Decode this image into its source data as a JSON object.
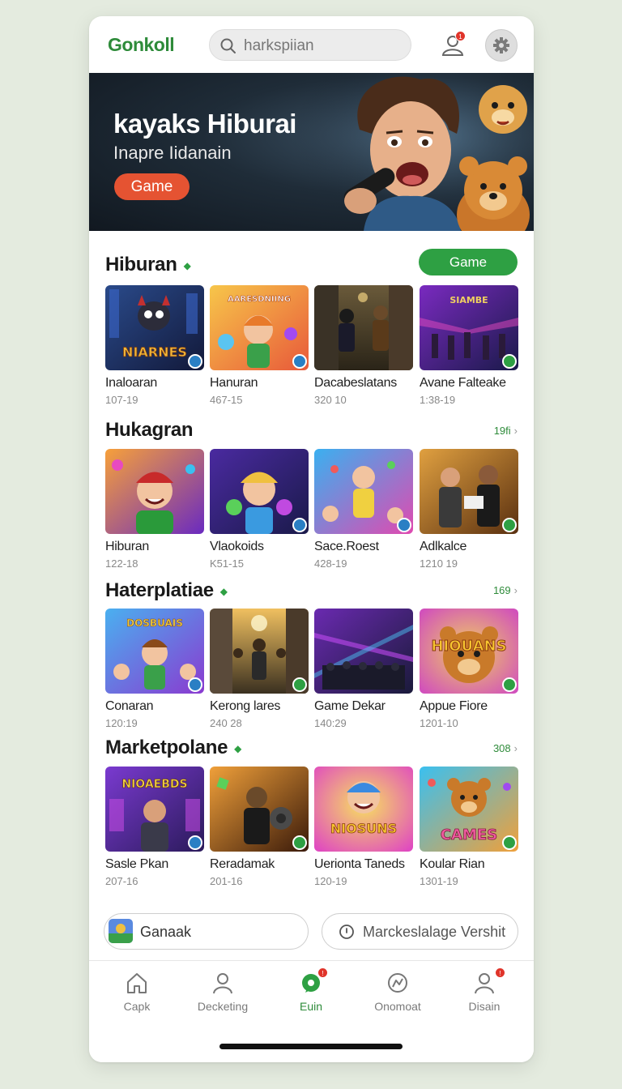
{
  "header": {
    "logo": "Gonkoll",
    "search_placeholder": "harkspiian",
    "notification_count": "1"
  },
  "banner": {
    "title": "kayaks Hiburai",
    "subtitle": "Inapre Iidanain",
    "button": "Game"
  },
  "sections": [
    {
      "title": "Hiburan",
      "action_button": "Game",
      "cards": [
        {
          "title": "Inaloaran",
          "meta": "107-19",
          "thumb_text": "NIARNES"
        },
        {
          "title": "Hanuran",
          "meta": "467-15",
          "thumb_text": "AARESDNIING"
        },
        {
          "title": "Dacabeslatans",
          "meta": "320 10"
        },
        {
          "title": "Avane Falteake",
          "meta": "1:38-19",
          "thumb_text": "SIAMBE"
        }
      ]
    },
    {
      "title": "Hukagran",
      "see_more": "19fi",
      "cards": [
        {
          "title": "Hiburan",
          "meta": "122-18"
        },
        {
          "title": "Vlaokoids",
          "meta": "K51-15"
        },
        {
          "title": "Sace.Roest",
          "meta": "428-19"
        },
        {
          "title": "Adlkalce",
          "meta": "1210 19"
        }
      ]
    },
    {
      "title": "Haterplatiae",
      "see_more": "169",
      "cards": [
        {
          "title": "Conaran",
          "meta": "120:19",
          "thumb_text": "DOSBUAIS"
        },
        {
          "title": "Kerong lares",
          "meta": "240 28"
        },
        {
          "title": "Game Dekar",
          "meta": "140:29"
        },
        {
          "title": "Appue Fiore",
          "meta": "1201-10",
          "thumb_text": "HIOUANS"
        }
      ]
    },
    {
      "title": "Marketpolane",
      "see_more": "308",
      "cards": [
        {
          "title": "Sasle Pkan",
          "meta": "207-16",
          "thumb_text": "NIOAEBDS"
        },
        {
          "title": "Reradamak",
          "meta": "201-16"
        },
        {
          "title": "Uerionta Taneds",
          "meta": "120-19",
          "thumb_text": "NIOSUNS"
        },
        {
          "title": "Koular Rian",
          "meta": "1301-19",
          "thumb_text": "CAMES"
        }
      ]
    }
  ],
  "quick_actions": {
    "left": "Ganaak",
    "right": "Marckeslalage Vershit"
  },
  "tabs": [
    {
      "label": "Capk",
      "icon": "home-icon"
    },
    {
      "label": "Decketing",
      "icon": "user-icon"
    },
    {
      "label": "Euin",
      "icon": "chat-icon"
    },
    {
      "label": "Onomoat",
      "icon": "gauge-icon"
    },
    {
      "label": "Disain",
      "icon": "profile-icon"
    }
  ],
  "colors": {
    "brand_green": "#2ea043",
    "accent_orange": "#e55332",
    "badge_red": "#e0342a"
  }
}
